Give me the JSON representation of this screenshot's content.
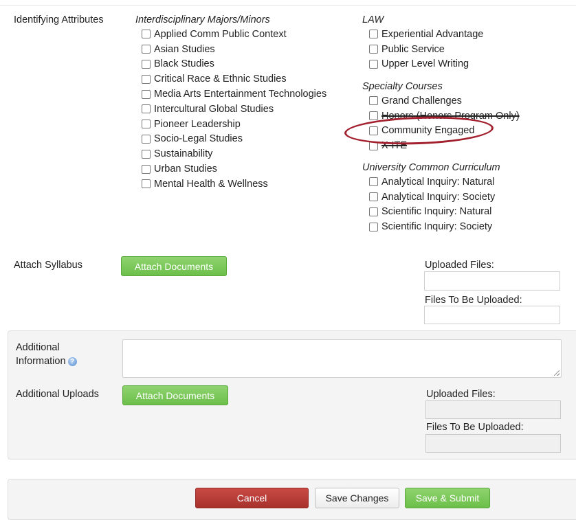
{
  "attributes": {
    "label": "Identifying Attributes",
    "groups": {
      "majors": {
        "title": "Interdisciplinary Majors/Minors",
        "items": [
          "Applied Comm Public Context",
          "Asian Studies",
          "Black Studies",
          "Critical Race & Ethnic Studies",
          "Media Arts Entertainment Technologies",
          "Intercultural Global Studies",
          "Pioneer Leadership",
          "Socio-Legal Studies",
          "Sustainability",
          "Urban Studies",
          "Mental Health & Wellness"
        ]
      },
      "law": {
        "title": "LAW",
        "items": [
          "Experiential Advantage",
          "Public Service",
          "Upper Level Writing"
        ]
      },
      "specialty": {
        "title": "Specialty Courses",
        "items": [
          "Grand Challenges",
          "Honors (Honors Program Only)",
          "Community Engaged",
          "X-ITE"
        ]
      },
      "ucc": {
        "title": "University Common Curriculum",
        "items": [
          "Analytical Inquiry: Natural",
          "Analytical Inquiry: Society",
          "Scientific Inquiry: Natural",
          "Scientific Inquiry: Society"
        ]
      }
    }
  },
  "syllabus": {
    "label": "Attach Syllabus",
    "button": "Attach Documents",
    "uploaded_label": "Uploaded Files:",
    "to_upload_label": "Files To Be Uploaded:"
  },
  "additional": {
    "info_label_line1": "Additional",
    "info_label_line2": "Information",
    "info_icon": "help-info-icon",
    "uploads_label": "Additional Uploads",
    "button": "Attach Documents",
    "uploaded_label": "Uploaded Files:",
    "to_upload_label": "Files To Be Uploaded:"
  },
  "footer": {
    "cancel": "Cancel",
    "save": "Save Changes",
    "submit": "Save & Submit"
  },
  "colors": {
    "highlight_oval": "#a3202f",
    "green_button": "#6cbf4a",
    "red_button": "#a8312c"
  }
}
